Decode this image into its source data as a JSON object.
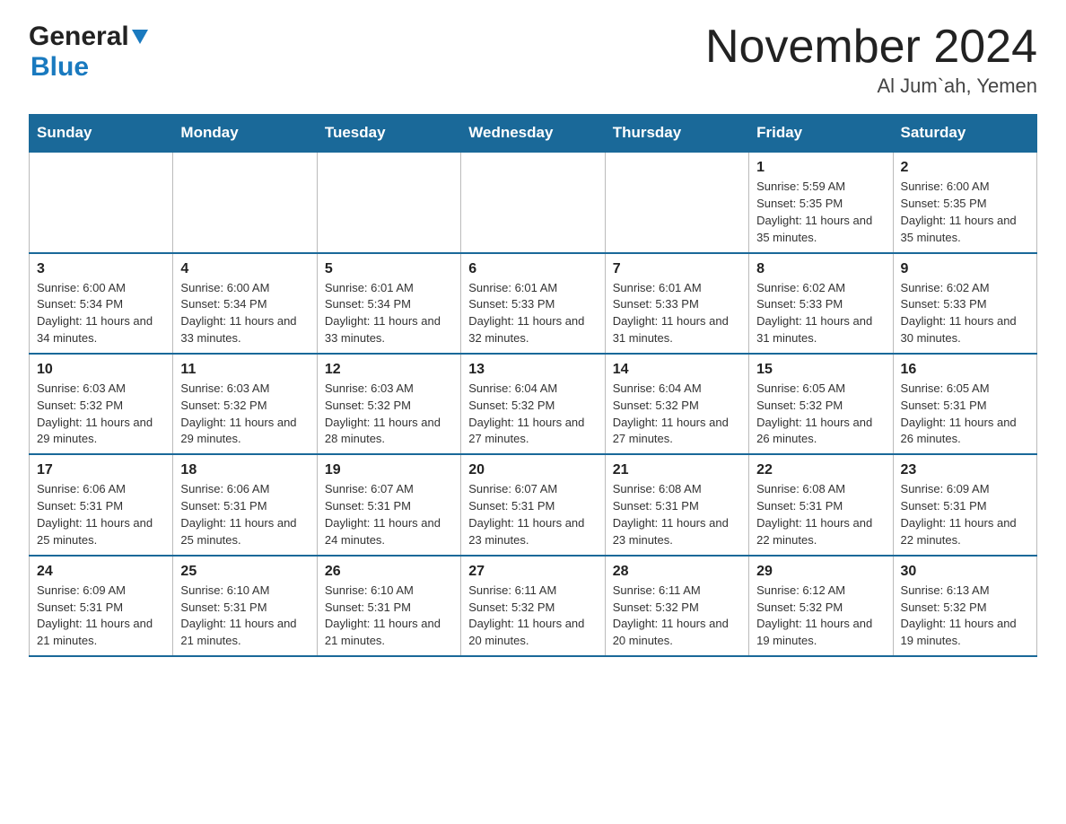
{
  "header": {
    "logo_general": "General",
    "logo_blue": "Blue",
    "month_year": "November 2024",
    "location": "Al Jum`ah, Yemen"
  },
  "weekdays": [
    "Sunday",
    "Monday",
    "Tuesday",
    "Wednesday",
    "Thursday",
    "Friday",
    "Saturday"
  ],
  "weeks": [
    [
      {
        "day": "",
        "info": ""
      },
      {
        "day": "",
        "info": ""
      },
      {
        "day": "",
        "info": ""
      },
      {
        "day": "",
        "info": ""
      },
      {
        "day": "",
        "info": ""
      },
      {
        "day": "1",
        "info": "Sunrise: 5:59 AM\nSunset: 5:35 PM\nDaylight: 11 hours and 35 minutes."
      },
      {
        "day": "2",
        "info": "Sunrise: 6:00 AM\nSunset: 5:35 PM\nDaylight: 11 hours and 35 minutes."
      }
    ],
    [
      {
        "day": "3",
        "info": "Sunrise: 6:00 AM\nSunset: 5:34 PM\nDaylight: 11 hours and 34 minutes."
      },
      {
        "day": "4",
        "info": "Sunrise: 6:00 AM\nSunset: 5:34 PM\nDaylight: 11 hours and 33 minutes."
      },
      {
        "day": "5",
        "info": "Sunrise: 6:01 AM\nSunset: 5:34 PM\nDaylight: 11 hours and 33 minutes."
      },
      {
        "day": "6",
        "info": "Sunrise: 6:01 AM\nSunset: 5:33 PM\nDaylight: 11 hours and 32 minutes."
      },
      {
        "day": "7",
        "info": "Sunrise: 6:01 AM\nSunset: 5:33 PM\nDaylight: 11 hours and 31 minutes."
      },
      {
        "day": "8",
        "info": "Sunrise: 6:02 AM\nSunset: 5:33 PM\nDaylight: 11 hours and 31 minutes."
      },
      {
        "day": "9",
        "info": "Sunrise: 6:02 AM\nSunset: 5:33 PM\nDaylight: 11 hours and 30 minutes."
      }
    ],
    [
      {
        "day": "10",
        "info": "Sunrise: 6:03 AM\nSunset: 5:32 PM\nDaylight: 11 hours and 29 minutes."
      },
      {
        "day": "11",
        "info": "Sunrise: 6:03 AM\nSunset: 5:32 PM\nDaylight: 11 hours and 29 minutes."
      },
      {
        "day": "12",
        "info": "Sunrise: 6:03 AM\nSunset: 5:32 PM\nDaylight: 11 hours and 28 minutes."
      },
      {
        "day": "13",
        "info": "Sunrise: 6:04 AM\nSunset: 5:32 PM\nDaylight: 11 hours and 27 minutes."
      },
      {
        "day": "14",
        "info": "Sunrise: 6:04 AM\nSunset: 5:32 PM\nDaylight: 11 hours and 27 minutes."
      },
      {
        "day": "15",
        "info": "Sunrise: 6:05 AM\nSunset: 5:32 PM\nDaylight: 11 hours and 26 minutes."
      },
      {
        "day": "16",
        "info": "Sunrise: 6:05 AM\nSunset: 5:31 PM\nDaylight: 11 hours and 26 minutes."
      }
    ],
    [
      {
        "day": "17",
        "info": "Sunrise: 6:06 AM\nSunset: 5:31 PM\nDaylight: 11 hours and 25 minutes."
      },
      {
        "day": "18",
        "info": "Sunrise: 6:06 AM\nSunset: 5:31 PM\nDaylight: 11 hours and 25 minutes."
      },
      {
        "day": "19",
        "info": "Sunrise: 6:07 AM\nSunset: 5:31 PM\nDaylight: 11 hours and 24 minutes."
      },
      {
        "day": "20",
        "info": "Sunrise: 6:07 AM\nSunset: 5:31 PM\nDaylight: 11 hours and 23 minutes."
      },
      {
        "day": "21",
        "info": "Sunrise: 6:08 AM\nSunset: 5:31 PM\nDaylight: 11 hours and 23 minutes."
      },
      {
        "day": "22",
        "info": "Sunrise: 6:08 AM\nSunset: 5:31 PM\nDaylight: 11 hours and 22 minutes."
      },
      {
        "day": "23",
        "info": "Sunrise: 6:09 AM\nSunset: 5:31 PM\nDaylight: 11 hours and 22 minutes."
      }
    ],
    [
      {
        "day": "24",
        "info": "Sunrise: 6:09 AM\nSunset: 5:31 PM\nDaylight: 11 hours and 21 minutes."
      },
      {
        "day": "25",
        "info": "Sunrise: 6:10 AM\nSunset: 5:31 PM\nDaylight: 11 hours and 21 minutes."
      },
      {
        "day": "26",
        "info": "Sunrise: 6:10 AM\nSunset: 5:31 PM\nDaylight: 11 hours and 21 minutes."
      },
      {
        "day": "27",
        "info": "Sunrise: 6:11 AM\nSunset: 5:32 PM\nDaylight: 11 hours and 20 minutes."
      },
      {
        "day": "28",
        "info": "Sunrise: 6:11 AM\nSunset: 5:32 PM\nDaylight: 11 hours and 20 minutes."
      },
      {
        "day": "29",
        "info": "Sunrise: 6:12 AM\nSunset: 5:32 PM\nDaylight: 11 hours and 19 minutes."
      },
      {
        "day": "30",
        "info": "Sunrise: 6:13 AM\nSunset: 5:32 PM\nDaylight: 11 hours and 19 minutes."
      }
    ]
  ]
}
